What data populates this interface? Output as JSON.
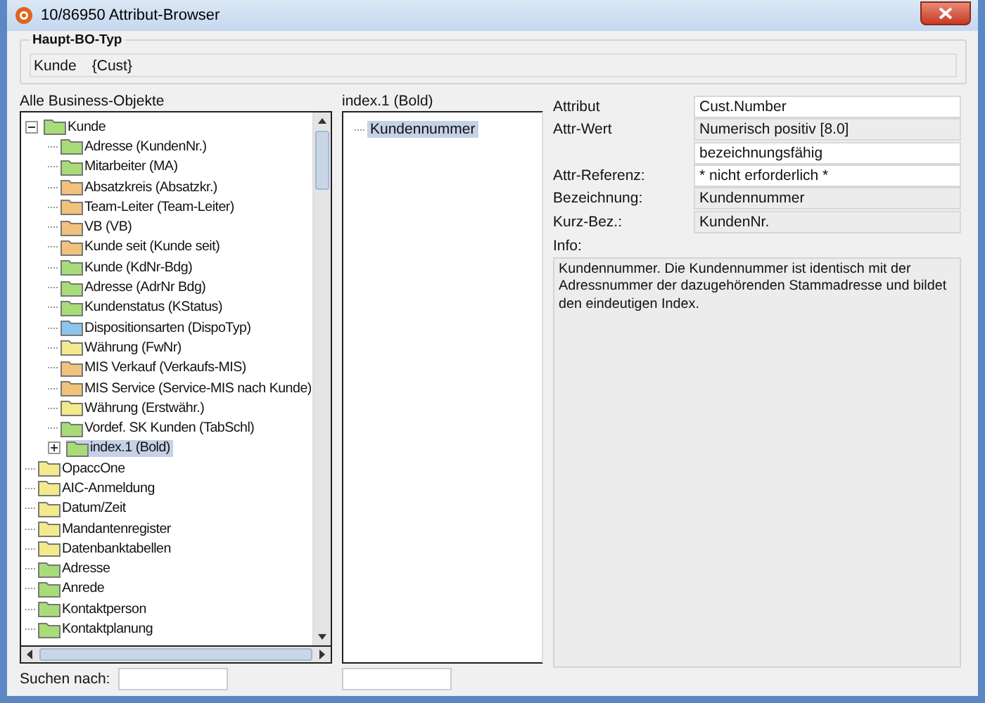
{
  "window": {
    "title": "10/86950 Attribut-Browser"
  },
  "main_type": {
    "legend": "Haupt-BO-Typ",
    "name": "Kunde",
    "code": "{Cust}"
  },
  "objects": {
    "heading": "Alle Business-Objekte",
    "tree": [
      {
        "label": "Kunde",
        "color": "#a8dc78",
        "expanded": true,
        "selected": false,
        "children": [
          {
            "label": "Adresse (KundenNr.)",
            "color": "#a8dc78",
            "selected": false
          },
          {
            "label": "Mitarbeiter (MA)",
            "color": "#a8dc78",
            "selected": false
          },
          {
            "label": "Absatzkreis (Absatzkr.)",
            "color": "#f0c27c",
            "selected": false
          },
          {
            "label": "Team-Leiter (Team-Leiter)",
            "color": "#f0c27c",
            "selected": false
          },
          {
            "label": "VB (VB)",
            "color": "#f0c27c",
            "selected": false
          },
          {
            "label": "Kunde seit (Kunde seit)",
            "color": "#f0c27c",
            "selected": false
          },
          {
            "label": "Kunde (KdNr-Bdg)",
            "color": "#a8dc78",
            "selected": false
          },
          {
            "label": "Adresse (AdrNr Bdg)",
            "color": "#a8dc78",
            "selected": false
          },
          {
            "label": "Kundenstatus (KStatus)",
            "color": "#a8dc78",
            "selected": false
          },
          {
            "label": "Dispositionsarten (DispoTyp)",
            "color": "#8cc4ee",
            "selected": false
          },
          {
            "label": "Währung (FwNr)",
            "color": "#f2ea8c",
            "selected": false
          },
          {
            "label": "MIS Verkauf (Verkaufs-MIS)",
            "color": "#f0c27c",
            "selected": false
          },
          {
            "label": "MIS Service (Service-MIS nach Kunde)",
            "color": "#f0c27c",
            "selected": false
          },
          {
            "label": "Währung (Erstwähr.)",
            "color": "#f2ea8c",
            "selected": false
          },
          {
            "label": "Vordef. SK Kunden (TabSchl)",
            "color": "#a8dc78",
            "selected": false
          },
          {
            "label": "index.1 (Bold)",
            "color": "#a8dc78",
            "expanded": false,
            "selected": true
          }
        ]
      },
      {
        "label": "OpaccOne",
        "color": "#f2ea8c",
        "selected": false
      },
      {
        "label": "AIC-Anmeldung",
        "color": "#f2ea8c",
        "selected": false
      },
      {
        "label": "Datum/Zeit",
        "color": "#f2ea8c",
        "selected": false
      },
      {
        "label": "Mandantenregister",
        "color": "#f2ea8c",
        "selected": false
      },
      {
        "label": "Datenbanktabellen",
        "color": "#f2ea8c",
        "selected": false
      },
      {
        "label": "Adresse",
        "color": "#a8dc78",
        "selected": false
      },
      {
        "label": "Anrede",
        "color": "#a8dc78",
        "selected": false
      },
      {
        "label": "Kontaktperson",
        "color": "#a8dc78",
        "selected": false
      },
      {
        "label": "Kontaktplanung",
        "color": "#a8dc78",
        "selected": false
      }
    ],
    "search_label": "Suchen nach:"
  },
  "index": {
    "heading": "index.1 (Bold)",
    "items": [
      {
        "label": "Kundennummer",
        "selected": true
      }
    ]
  },
  "details": {
    "rows": [
      {
        "label": "Attribut",
        "values": [
          {
            "text": "Cust.Number",
            "editable": true
          }
        ]
      },
      {
        "label": "Attr-Wert",
        "values": [
          {
            "text": "Numerisch positiv [8.0]",
            "editable": false
          },
          {
            "text": "bezeichnungsfähig",
            "editable": true
          }
        ]
      },
      {
        "label": "Attr-Referenz:",
        "values": [
          {
            "text": " * nicht erforderlich *",
            "editable": true
          }
        ]
      },
      {
        "label": "Bezeichnung:",
        "values": [
          {
            "text": "Kundennummer",
            "editable": false
          }
        ]
      },
      {
        "label": "Kurz-Bez.:",
        "values": [
          {
            "text": "KundenNr.",
            "editable": false
          }
        ]
      }
    ],
    "info_label": "Info:",
    "info_text": "Kundennummer. Die Kundennummer ist identisch mit der Adressnummer der dazugehörenden Stammadresse und bildet den eindeutigen Index."
  }
}
